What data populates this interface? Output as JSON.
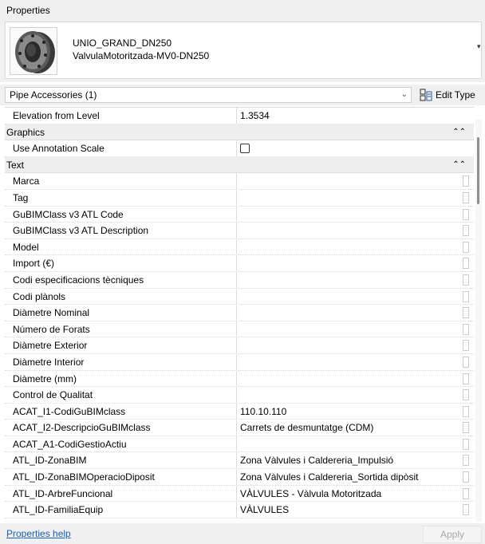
{
  "window": {
    "title": "Properties"
  },
  "type_selector": {
    "family": "UNIO_GRAND_DN250",
    "type": "ValvulaMotoritzada-MV0-DN250",
    "thumbnail_icon": "valve-flange-icon",
    "dropdown_icon": "dropdown-arrow-icon"
  },
  "filter": {
    "selected": "Pipe Accessories (1)",
    "chevron_icon": "chevron-down-icon",
    "edit_type_label": "Edit Type",
    "edit_type_icon": "edit-type-icon"
  },
  "properties": {
    "top_row": {
      "name": "Elevation from Level",
      "value": "1.3534"
    },
    "graphics": {
      "title": "Graphics",
      "rows": [
        {
          "name": "Use Annotation Scale",
          "checked": false
        }
      ]
    },
    "text": {
      "title": "Text",
      "rows": [
        {
          "name": "Marca",
          "value": ""
        },
        {
          "name": "Tag",
          "value": ""
        },
        {
          "name": "GuBIMClass v3 ATL Code",
          "value": ""
        },
        {
          "name": "GuBIMClass v3 ATL Description",
          "value": ""
        },
        {
          "name": "Model",
          "value": ""
        },
        {
          "name": "Import (€)",
          "value": ""
        },
        {
          "name": "Codi especificacions tècniques",
          "value": ""
        },
        {
          "name": "Codi plànols",
          "value": ""
        },
        {
          "name": "Diàmetre Nominal",
          "value": ""
        },
        {
          "name": "Número de Forats",
          "value": ""
        },
        {
          "name": "Diàmetre Exterior",
          "value": ""
        },
        {
          "name": "Diàmetre Interior",
          "value": ""
        },
        {
          "name": "Diàmetre (mm)",
          "value": ""
        },
        {
          "name": "Control de Qualitat",
          "value": ""
        },
        {
          "name": "ACAT_I1-CodiGuBIMclass",
          "value": "110.10.110"
        },
        {
          "name": "ACAT_I2-DescripcioGuBIMclass",
          "value": "Carrets de desmuntatge (CDM)"
        },
        {
          "name": "ACAT_A1-CodiGestioActiu",
          "value": ""
        },
        {
          "name": "ATL_ID-ZonaBIM",
          "value": "Zona Vàlvules i Caldereria_Impulsió"
        },
        {
          "name": "ATL_ID-ZonaBIMOperacioDiposit",
          "value": "Zona Vàlvules i Caldereria_Sortida dipòsit"
        },
        {
          "name": "ATL_ID-ArbreFuncional",
          "value": "VÀLVULES - Vàlvula Motoritzada"
        },
        {
          "name": "ATL_ID-FamiliaEquip",
          "value": "VÀLVULES"
        }
      ]
    }
  },
  "footer": {
    "help_link": "Properties help",
    "apply_label": "Apply"
  }
}
